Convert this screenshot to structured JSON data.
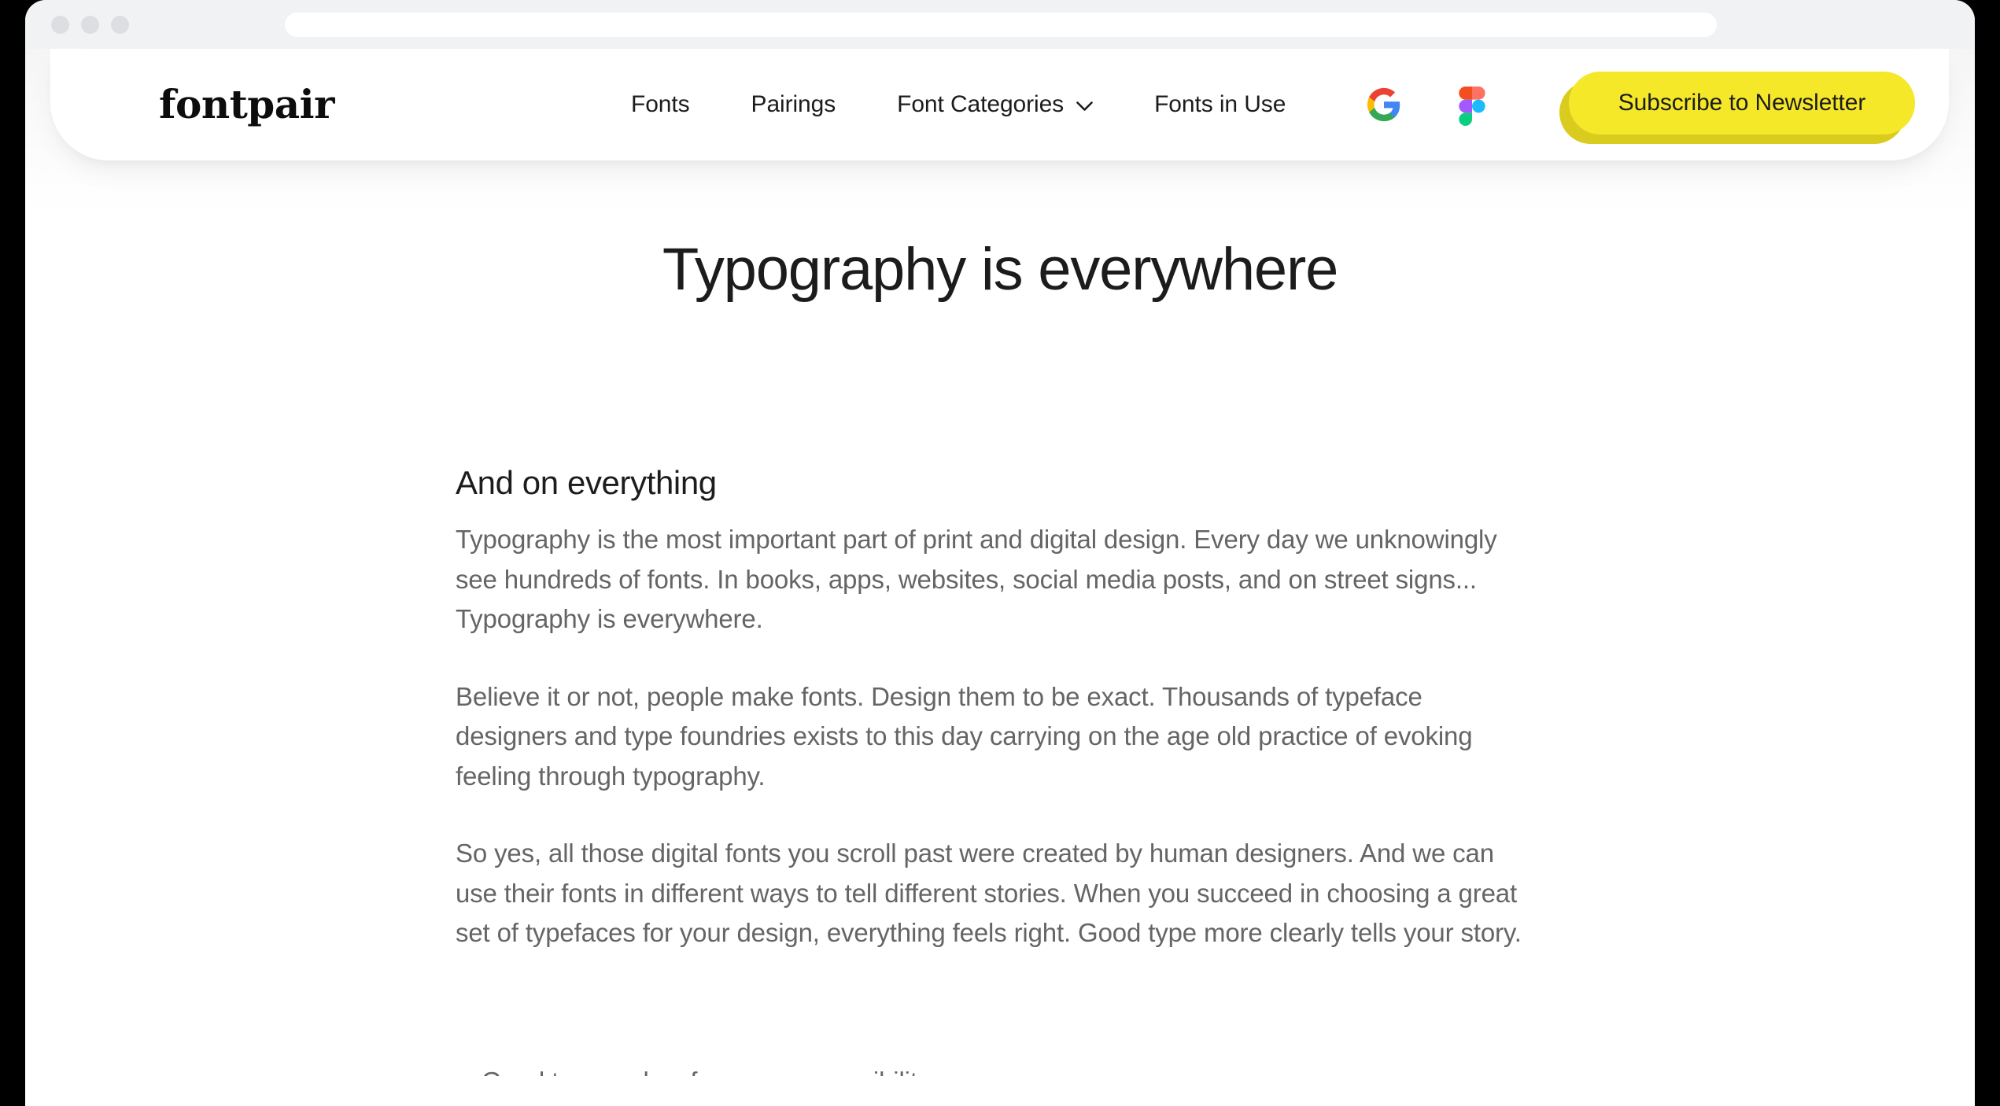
{
  "browser": {
    "traffic_lights": [
      "close",
      "minimize",
      "maximize"
    ],
    "address_bar_value": "",
    "address_bar_placeholder": ""
  },
  "header": {
    "logo_text": "fontpair",
    "nav": [
      {
        "label": "Fonts",
        "name": "nav-item-fonts",
        "has_dropdown": false
      },
      {
        "label": "Pairings",
        "name": "nav-item-pairings",
        "has_dropdown": false
      },
      {
        "label": "Font Categories",
        "name": "nav-item-font-categories",
        "has_dropdown": true
      },
      {
        "label": "Fonts in Use",
        "name": "nav-item-fonts-in-use",
        "has_dropdown": false
      }
    ],
    "brand_icons": [
      {
        "name": "google-icon",
        "title": "Google"
      },
      {
        "name": "figma-icon",
        "title": "Figma"
      }
    ],
    "cta": {
      "label": "Subscribe to Newsletter",
      "bg_color": "#F5E828",
      "shadow_color": "#D9CC1F",
      "text_color": "#1C1C1C"
    }
  },
  "hero": {
    "title": "Typography is everywhere"
  },
  "article": {
    "section_title": "And on everything",
    "paragraphs": [
      "Typography is the most important part of print and digital design. Every day we unknowingly see hundreds of fonts. In books, apps, websites, social media posts, and on street signs... Typography is everywhere.",
      "Believe it or not, people make fonts. Design them to be exact. Thousands of typeface designers and type foundries exists to this day carrying on the age old practice of evoking feeling through typography.",
      "So yes, all those digital fonts you scroll past were created by human designers. And we can use their fonts in different ways to tell different stories. When you succeed in choosing a great set of typefaces for your design, everything feels right. Good type more clearly tells your story."
    ],
    "clipped_bullet_text": "Good type makes for more accessibility"
  },
  "colors": {
    "page_background": "#FFFFFF",
    "titlebar": "#F1F2F4",
    "heading_text": "#1C1C1C",
    "body_text": "#656565",
    "accent_yellow": "#F5E828"
  }
}
